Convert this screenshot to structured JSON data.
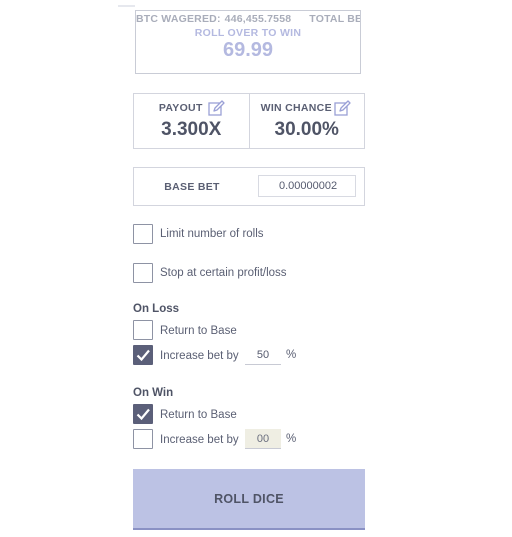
{
  "stats": {
    "btc_wagered_label": "BTC WAGERED:",
    "btc_wagered_value": "446,455.7558",
    "total_bets_label": "TOTAL BETS"
  },
  "roll_over": {
    "label": "ROLL OVER TO WIN",
    "value": "69.99"
  },
  "payout": {
    "label": "PAYOUT",
    "value": "3.300X",
    "icon": "edit-icon"
  },
  "win_chance": {
    "label": "WIN CHANCE",
    "value": "30.00%",
    "icon": "edit-icon"
  },
  "base_bet": {
    "label": "BASE BET",
    "value": "0.00000002"
  },
  "options": {
    "limit_rolls": {
      "label": "Limit number of rolls",
      "checked": false
    },
    "stop_profit_loss": {
      "label": "Stop at certain profit/loss",
      "checked": false
    }
  },
  "on_loss": {
    "title": "On Loss",
    "return_to_base": {
      "label": "Return to Base",
      "checked": false
    },
    "increase_bet": {
      "label": "Increase bet by",
      "checked": true,
      "value": "50",
      "unit": "%"
    }
  },
  "on_win": {
    "title": "On Win",
    "return_to_base": {
      "label": "Return to Base",
      "checked": true
    },
    "increase_bet": {
      "label": "Increase bet by",
      "checked": false,
      "value": "00",
      "unit": "%"
    }
  },
  "roll_button": {
    "label": "ROLL DICE"
  },
  "colors": {
    "accent": "#bcc2e4",
    "checkbox_checked": "#5b5f79",
    "edit_icon": "#9aa0d6"
  }
}
